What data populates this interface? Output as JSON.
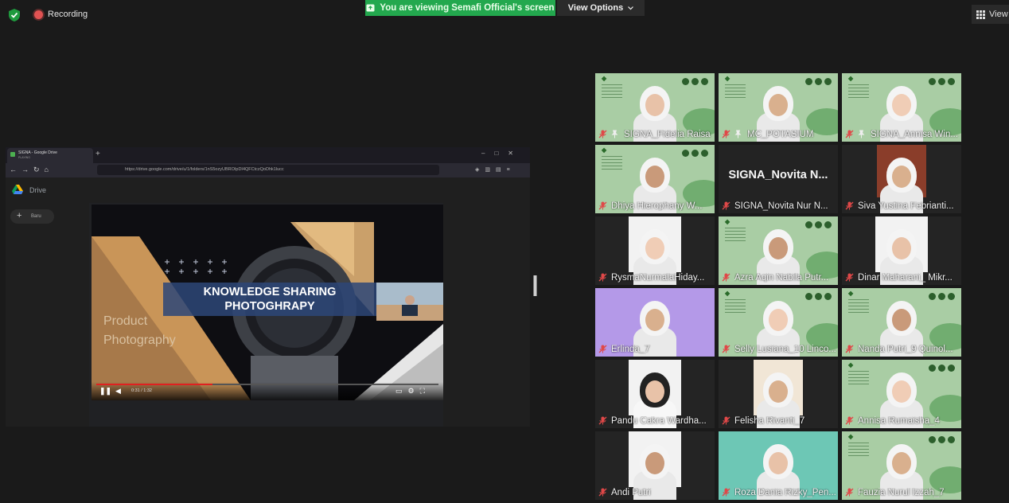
{
  "top_bar": {
    "recording_label": "Recording",
    "share_banner": "You are viewing Semafi Official's screen",
    "view_options": "View Options",
    "view_label": "View"
  },
  "browser": {
    "tab_title": "SIGNA - Google Drive",
    "tab_subtitle": "PLAYING",
    "url": "https://drive.google.com/drive/u/1/folders/1nS5ozyUBROIpDI4QFCtczQoDhk1lucc",
    "drive_label": "Drive",
    "new_label": "Baru"
  },
  "video": {
    "title_line1": "KNOWLEDGE SHARING",
    "title_line2": "PHOTOGHRAPY",
    "side_label1": "Product",
    "side_label2": "Photography",
    "time": "0:31 / 1:32",
    "progress_fraction": 0.34
  },
  "colors": {
    "accent_green": "#23a84e",
    "active_speaker": "#d8e36b",
    "muted_red": "#e04848",
    "potasium_bg": "#a9cda4"
  },
  "participants": [
    {
      "name": "SIGNA_Fidelia Raisa",
      "bg": "potasium",
      "pinned": true,
      "active": false
    },
    {
      "name": "MC_POTASIUM",
      "bg": "potasium",
      "pinned": true,
      "active": false
    },
    {
      "name": "SIGNA_Annisa Win...",
      "bg": "potasium",
      "pinned": true,
      "active": true
    },
    {
      "name": "Dhiya Hierophany W...",
      "bg": "potasium",
      "pinned": false,
      "active": false
    },
    {
      "name": "SIGNA_Novita Nur N...",
      "bg": "dark",
      "big_name": "SIGNA_Novita  N...",
      "pinned": false,
      "active": false
    },
    {
      "name": "Siva Yustina Febrianti...",
      "bg": "room",
      "pinned": false,
      "active": false
    },
    {
      "name": "RysmaNurmalaHiday...",
      "bg": "white",
      "pinned": false,
      "active": false
    },
    {
      "name": "Azra Aqin Nabila Putr...",
      "bg": "potasium",
      "pinned": false,
      "active": false
    },
    {
      "name": "Dinar Maharani_ Mikr...",
      "bg": "white",
      "pinned": false,
      "active": false
    },
    {
      "name": "Erlinda_7",
      "bg": "purple",
      "pinned": false,
      "active": false
    },
    {
      "name": "Selly Lusiana_10 Linco...",
      "bg": "potasium",
      "pinned": false,
      "active": false
    },
    {
      "name": "Nanda Putri_9 Quinol...",
      "bg": "potasium",
      "pinned": false,
      "active": false
    },
    {
      "name": "Pandu Cakra Wardha...",
      "bg": "white",
      "pinned": false,
      "active": false
    },
    {
      "name": "Felisha Rivanti_7",
      "bg": "cream",
      "pinned": false,
      "active": false
    },
    {
      "name": "Annisa Rumaisha_4",
      "bg": "potasium",
      "pinned": false,
      "active": false
    },
    {
      "name": "Andi Putri",
      "bg": "white",
      "pinned": false,
      "active": false
    },
    {
      "name": "Roza Dania Rizky_Pen...",
      "bg": "teal",
      "pinned": false,
      "active": false
    },
    {
      "name": "Fauzia Nurul Izzah_7",
      "bg": "potasium",
      "pinned": false,
      "active": false
    }
  ]
}
